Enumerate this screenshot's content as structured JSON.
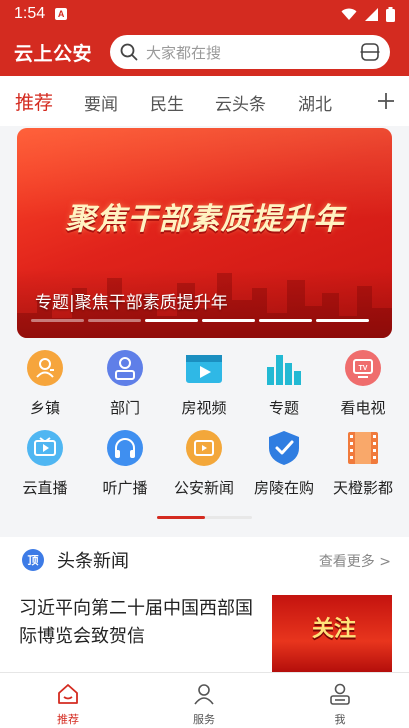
{
  "status_bar": {
    "time": "1:54",
    "badge": "A"
  },
  "header": {
    "brand": "云上公安",
    "search_placeholder": "大家都在搜"
  },
  "tabs": [
    {
      "label": "推荐",
      "active": true
    },
    {
      "label": "要闻"
    },
    {
      "label": "民生"
    },
    {
      "label": "云头条"
    },
    {
      "label": "湖北"
    }
  ],
  "banner": {
    "headline": "聚焦干部素质提升年",
    "caption": "专题|聚焦干部素质提升年",
    "slide_count": 6,
    "active_slide": 3
  },
  "grid": [
    {
      "label": "乡镇",
      "icon": "town-icon"
    },
    {
      "label": "部门",
      "icon": "department-icon"
    },
    {
      "label": "房视频",
      "icon": "video-play-icon"
    },
    {
      "label": "专题",
      "icon": "bar-chart-icon"
    },
    {
      "label": "看电视",
      "icon": "tv-icon"
    },
    {
      "label": "云直播",
      "icon": "live-tv-icon"
    },
    {
      "label": "听广播",
      "icon": "headphones-icon"
    },
    {
      "label": "公安新闻",
      "icon": "news-play-icon"
    },
    {
      "label": "房陵在购",
      "icon": "shield-check-icon"
    },
    {
      "label": "天橙影都",
      "icon": "film-icon"
    }
  ],
  "grid_page": {
    "current": 1,
    "total": 2
  },
  "news": {
    "badge": "顶",
    "section_title": "头条新闻",
    "more_label": "查看更多 >",
    "article_title": "习近平向第二十届中国西部国际博览会致贺信",
    "thumb_text": "关注"
  },
  "bottom_nav": [
    {
      "label": "推荐",
      "icon": "home-icon",
      "active": true
    },
    {
      "label": "服务",
      "icon": "service-person-icon"
    },
    {
      "label": "我",
      "icon": "profile-icon"
    }
  ],
  "colors": {
    "brand_red": "#d42b20",
    "accent_blue": "#3d7be6"
  }
}
